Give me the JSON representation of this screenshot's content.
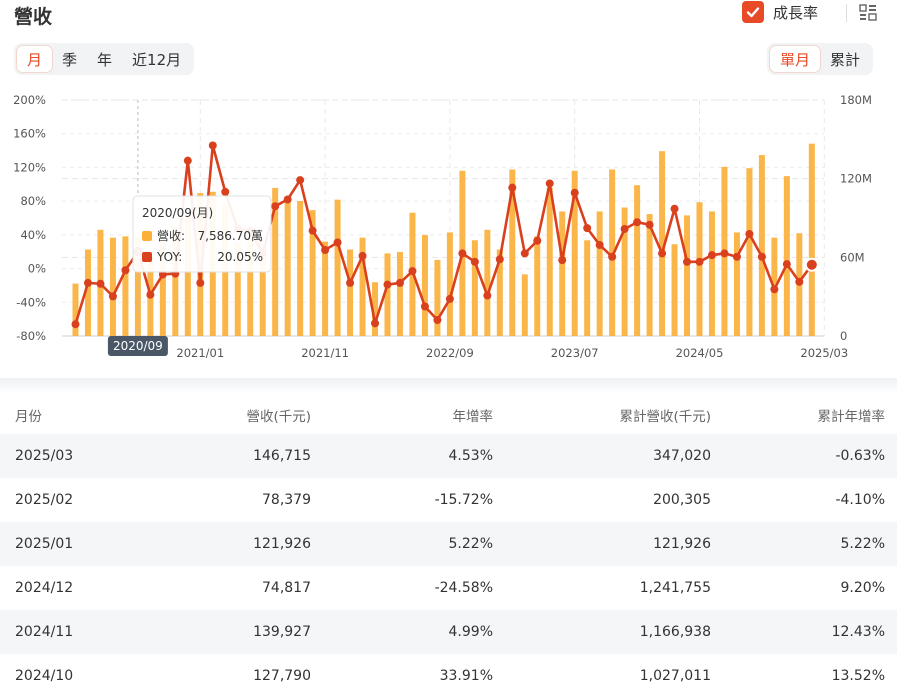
{
  "header": {
    "title": "營收",
    "growth_label": "成長率"
  },
  "period_tabs": [
    {
      "label": "月",
      "active": true
    },
    {
      "label": "季",
      "active": false
    },
    {
      "label": "年",
      "active": false
    },
    {
      "label": "近12月",
      "active": false
    }
  ],
  "mode_tabs": [
    {
      "label": "單月",
      "active": true
    },
    {
      "label": "累計",
      "active": false
    }
  ],
  "colors": {
    "accent": "#e84a27",
    "bar": "#fbb03b",
    "line": "#d9401e"
  },
  "chart_data": {
    "type": "bar",
    "left_axis_ticks": [
      "200%",
      "160%",
      "120%",
      "80%",
      "40%",
      "0%",
      "-40%",
      "-80%"
    ],
    "right_axis_ticks": [
      "180M",
      "120M",
      "60M",
      "0"
    ],
    "x_tick_labels": [
      "2020/09",
      "2021/01",
      "2021/11",
      "2022/09",
      "2023/07",
      "2024/05",
      "2025/03"
    ],
    "ylim_left": [
      -80,
      200
    ],
    "ylim_right": [
      0,
      180000
    ],
    "start_month": "2020/01",
    "series": [
      {
        "name": "營收",
        "axis": "right",
        "unit": "千元",
        "values": [
          40000,
          66000,
          81000,
          75000,
          76000,
          75868,
          60000,
          73000,
          83000,
          91000,
          109000,
          110000,
          100000,
          71000,
          75000,
          70000,
          113000,
          103000,
          103000,
          96000,
          72000,
          104000,
          66000,
          75000,
          41000,
          63000,
          64000,
          94000,
          77000,
          58000,
          79000,
          126000,
          73000,
          81000,
          66000,
          127000,
          47000,
          76000,
          113000,
          95000,
          126000,
          73000,
          95000,
          127000,
          98000,
          115000,
          93000,
          141000,
          70000,
          92000,
          102000,
          95000,
          129000,
          79000,
          128000,
          138000,
          75000,
          121926,
          78379,
          146715
        ]
      },
      {
        "name": "YOY",
        "axis": "left",
        "unit": "%",
        "values": [
          -66,
          -17,
          -18,
          -33,
          -2,
          20.05,
          -31,
          -7,
          -6,
          128,
          -17,
          146,
          91,
          47,
          45,
          18,
          74,
          82,
          105,
          45,
          22,
          31,
          -17,
          15,
          -65,
          -19,
          -17,
          -3,
          -45,
          -61,
          -36,
          18,
          8,
          -32,
          11,
          96,
          18,
          33,
          101,
          10,
          90,
          48,
          28,
          14,
          47,
          55,
          52,
          18,
          71,
          8,
          8,
          16,
          18,
          14,
          41,
          14,
          -24.58,
          5.22,
          -15.72,
          4.53
        ]
      }
    ],
    "tooltip": {
      "title": "2020/09(月)",
      "revenue_label": "營收:",
      "revenue_value": "7,586.70萬",
      "yoy_label": "YOY:",
      "yoy_value": "20.05%"
    },
    "highlight_label": "2020/09",
    "highlight_index": 5
  },
  "table": {
    "columns": [
      "月份",
      "營收(千元)",
      "年增率",
      "累計營收(千元)",
      "累計年增率"
    ],
    "rows": [
      [
        "2025/03",
        "146,715",
        "4.53%",
        "347,020",
        "-0.63%"
      ],
      [
        "2025/02",
        "78,379",
        "-15.72%",
        "200,305",
        "-4.10%"
      ],
      [
        "2025/01",
        "121,926",
        "5.22%",
        "121,926",
        "5.22%"
      ],
      [
        "2024/12",
        "74,817",
        "-24.58%",
        "1,241,755",
        "9.20%"
      ],
      [
        "2024/11",
        "139,927",
        "4.99%",
        "1,166,938",
        "12.43%"
      ],
      [
        "2024/10",
        "127,790",
        "33.91%",
        "1,027,011",
        "13.52%"
      ]
    ]
  }
}
